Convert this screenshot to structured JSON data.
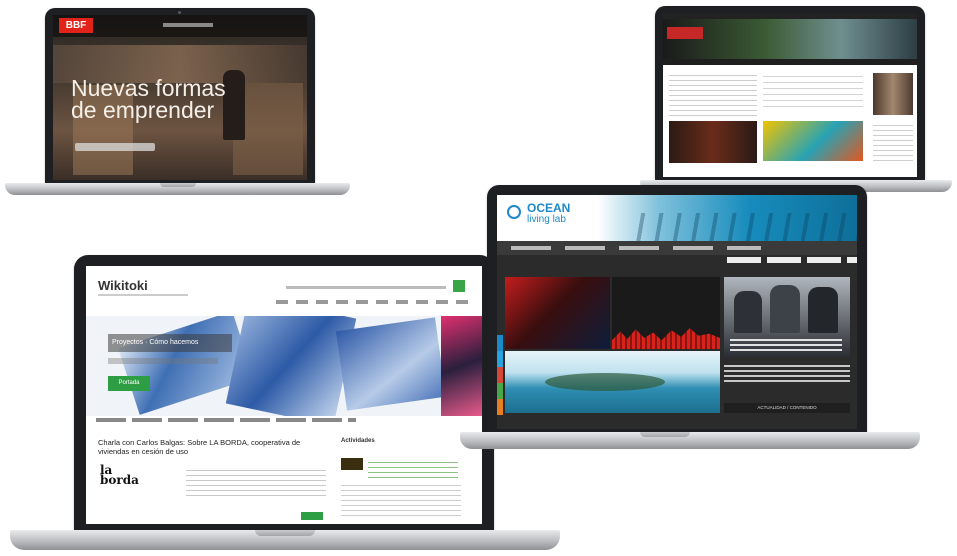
{
  "bbf": {
    "logo": "BBF",
    "headline_1": "Nuevas formas",
    "headline_2": "de emprender"
  },
  "wikitoki": {
    "site_title": "Wikitoki",
    "slider_text": "Proyectos · Cómo hacemos",
    "cta_label": "Portada",
    "article_title_1": "Charla con Carlos Balgas: Sobre LA BORDA, cooperativa de",
    "article_title_2": "viviendas en cesión de uso",
    "logo_line_1": "la",
    "logo_line_2": "borda",
    "sidebar_title": "Actividades"
  },
  "ocean": {
    "brand_line_1": "OCEAN",
    "brand_line_2": "living lab",
    "brand_color": "#1e88c8"
  },
  "ocean_link_text": "ACTUALIDAD / CONTENIDO"
}
